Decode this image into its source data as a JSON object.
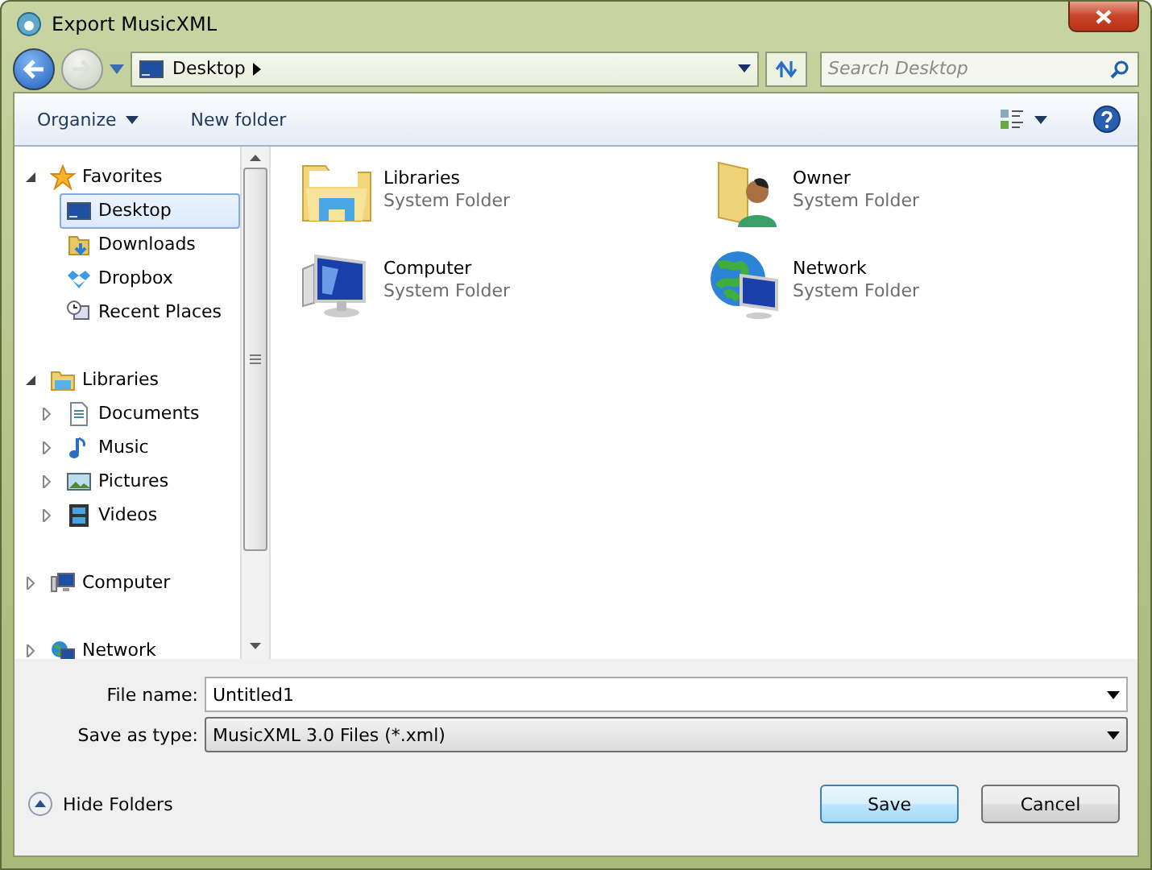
{
  "window": {
    "title": "Export MusicXML"
  },
  "address": {
    "location": "Desktop"
  },
  "search": {
    "placeholder": "Search Desktop"
  },
  "toolbar": {
    "organize": "Organize",
    "new_folder": "New folder"
  },
  "sidebar": {
    "groups": [
      {
        "label": "Favorites",
        "expanded": true,
        "selected": false,
        "children": [
          {
            "label": "Desktop",
            "selected": true
          },
          {
            "label": "Downloads",
            "selected": false
          },
          {
            "label": "Dropbox",
            "selected": false
          },
          {
            "label": "Recent Places",
            "selected": false
          }
        ]
      },
      {
        "label": "Libraries",
        "expanded": true,
        "selected": false,
        "children": [
          {
            "label": "Documents",
            "selected": false,
            "expanded": false
          },
          {
            "label": "Music",
            "selected": false,
            "expanded": false
          },
          {
            "label": "Pictures",
            "selected": false,
            "expanded": false
          },
          {
            "label": "Videos",
            "selected": false,
            "expanded": false
          }
        ]
      },
      {
        "label": "Computer",
        "expanded": false,
        "selected": false
      },
      {
        "label": "Network",
        "expanded": false,
        "selected": false
      }
    ]
  },
  "items": [
    {
      "name": "Libraries",
      "type": "System Folder"
    },
    {
      "name": "Owner",
      "type": "System Folder"
    },
    {
      "name": "Computer",
      "type": "System Folder"
    },
    {
      "name": "Network",
      "type": "System Folder"
    }
  ],
  "form": {
    "file_name_label": "File name:",
    "file_name": "Untitled1",
    "type_label": "Save as type:",
    "type": "MusicXML 3.0 Files (*.xml)"
  },
  "footer": {
    "hide_folders": "Hide Folders",
    "buttons": [
      "Save",
      "Cancel"
    ]
  }
}
